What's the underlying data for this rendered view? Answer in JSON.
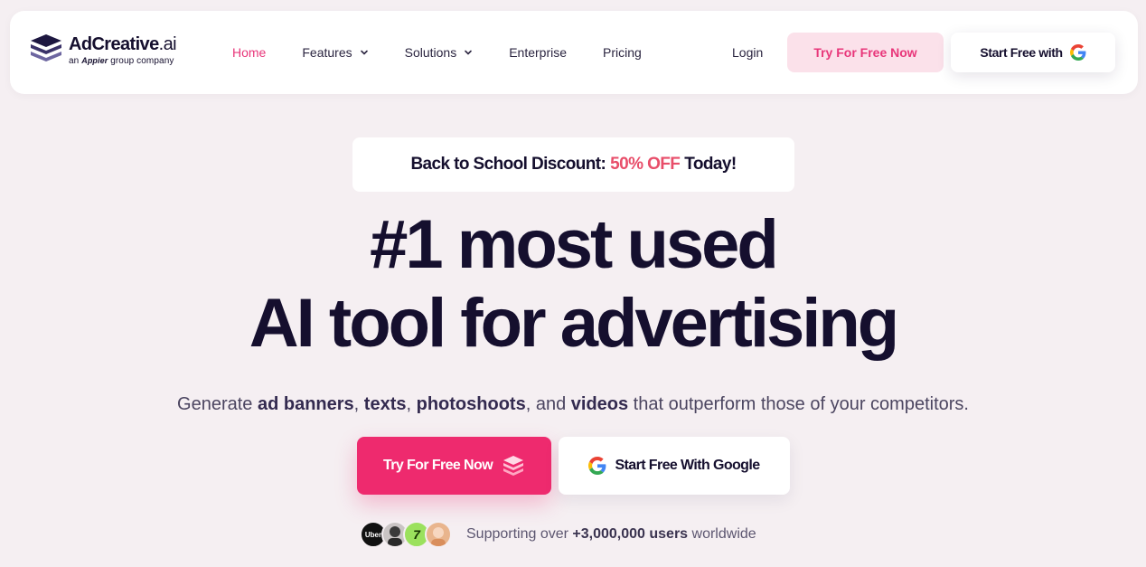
{
  "nav": {
    "logo": {
      "name_main": "AdCreative",
      "name_suffix": ".ai",
      "sub_prefix": "an",
      "sub_brand": "Appier",
      "sub_suffix": "group company"
    },
    "links": [
      {
        "label": "Home",
        "active": true,
        "dropdown": false
      },
      {
        "label": "Features",
        "active": false,
        "dropdown": true
      },
      {
        "label": "Solutions",
        "active": false,
        "dropdown": true
      },
      {
        "label": "Enterprise",
        "active": false,
        "dropdown": false
      },
      {
        "label": "Pricing",
        "active": false,
        "dropdown": false
      }
    ],
    "login_label": "Login",
    "try_label": "Try For Free Now",
    "google_label": "Start Free with"
  },
  "hero": {
    "promo_prefix": "Back to School Discount:",
    "promo_highlight": "50% OFF",
    "promo_suffix": "Today!",
    "headline_line1": "#1 most used",
    "headline_line2": "AI tool for advertising",
    "sub": {
      "p1": "Generate ",
      "b1": "ad banners",
      "p2": ", ",
      "b2": "texts",
      "p3": ", ",
      "b3": "photoshoots",
      "p4": ", and ",
      "b4": "videos",
      "p5": " that outperform those of your competitors."
    },
    "cta_primary_label": "Try For Free Now",
    "cta_google_label": "Start Free With Google",
    "social": {
      "avatar1_text": "Uber",
      "avatar3_text": "7",
      "prefix": "Supporting over ",
      "count": "+3,000,000 users",
      "suffix": " worldwide"
    }
  },
  "colors": {
    "accent": "#ee2a6e",
    "accent_light": "#fbe1ea",
    "text_dark": "#150f2e",
    "background": "#f5eff2"
  },
  "icons": [
    "adcreative-logo-icon",
    "chevron-down-icon",
    "google-g-icon",
    "cube-stack-icon"
  ]
}
